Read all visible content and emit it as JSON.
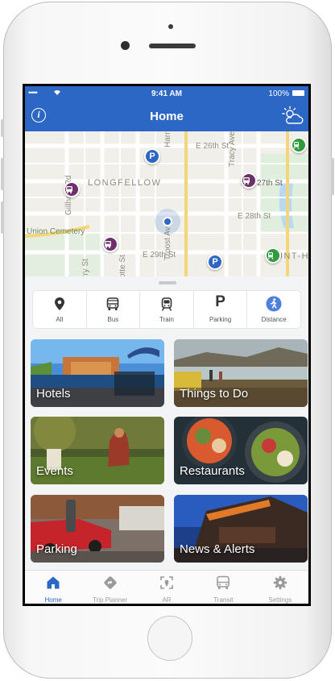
{
  "status_bar": {
    "signal": "•••••",
    "time": "9:41 AM",
    "battery": "100%"
  },
  "header": {
    "title": "Home",
    "info_label": "i"
  },
  "map": {
    "streets": [
      "E 26th St",
      "27th St",
      "E 28th St",
      "E 29th St",
      "Troost Ave",
      "Tracy Ave",
      "Harrison",
      "Gillham Rd",
      "rry St",
      "otte St"
    ],
    "neighborhoods": [
      "LONGFELLOW",
      "UNT-H"
    ],
    "places": [
      "Union Cemetery"
    ],
    "pin_markers": {
      "parking": "P"
    }
  },
  "filters": [
    {
      "label": "All",
      "icon": "map-pin-icon"
    },
    {
      "label": "Bus",
      "icon": "bus-icon"
    },
    {
      "label": "Train",
      "icon": "train-icon"
    },
    {
      "label": "Parking",
      "icon": "parking-icon",
      "glyph": "P"
    },
    {
      "label": "Distance",
      "icon": "walking-icon"
    }
  ],
  "tiles": [
    {
      "label": "Hotels"
    },
    {
      "label": "Things to Do"
    },
    {
      "label": "Events"
    },
    {
      "label": "Restaurants"
    },
    {
      "label": "Parking"
    },
    {
      "label": "News & Alerts"
    }
  ],
  "tabs": [
    {
      "label": "Home",
      "icon": "home-icon"
    },
    {
      "label": "Trip Planner",
      "icon": "directions-icon"
    },
    {
      "label": "AR",
      "icon": "ar-icon"
    },
    {
      "label": "Transit",
      "icon": "bus-icon"
    },
    {
      "label": "Settings",
      "icon": "gear-icon"
    }
  ],
  "colors": {
    "accent": "#2d67c5",
    "transit_purple": "#6e2f6a",
    "train_green": "#2e9c3b"
  }
}
